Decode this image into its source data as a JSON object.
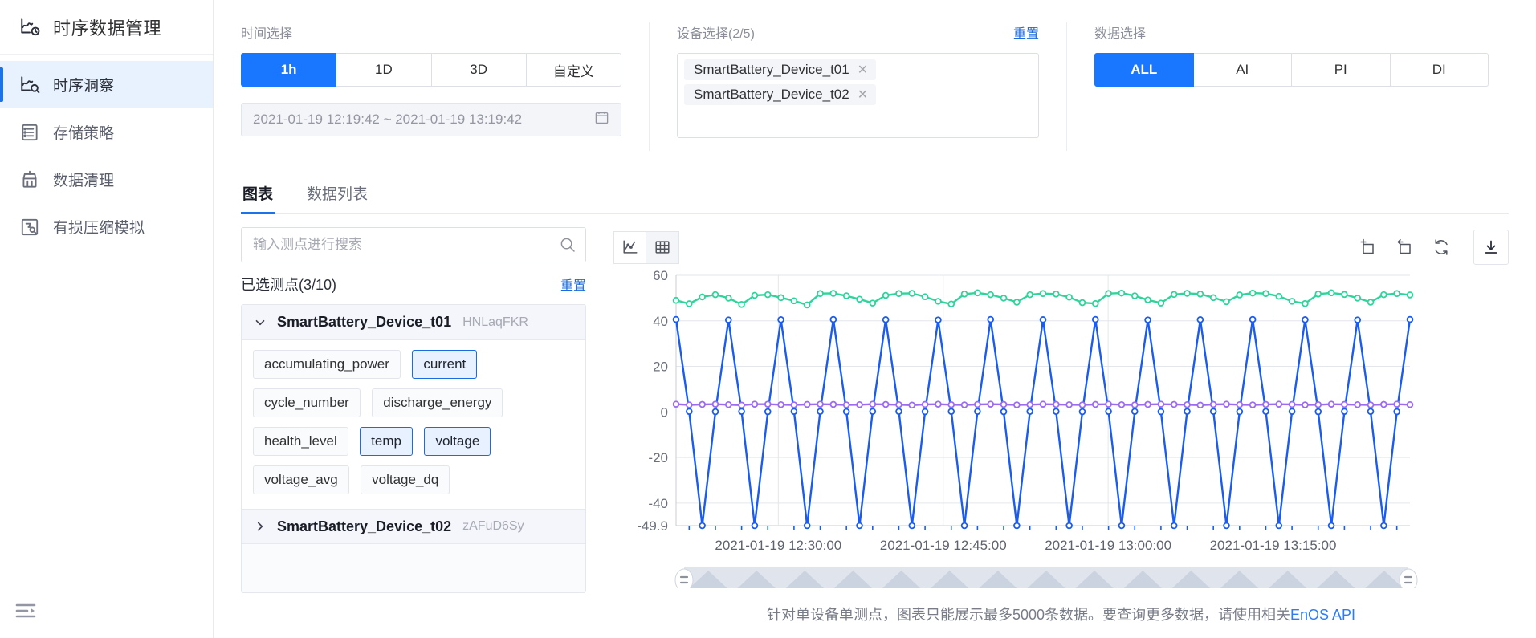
{
  "sidebar": {
    "brand": {
      "title": "时序数据管理",
      "icon": "timeseries-logo-icon"
    },
    "items": [
      {
        "label": "时序洞察",
        "icon": "insight-chart-icon",
        "active": true
      },
      {
        "label": "存储策略",
        "icon": "storage-policy-icon",
        "active": false
      },
      {
        "label": "数据清理",
        "icon": "data-clean-icon",
        "active": false
      },
      {
        "label": "有损压缩模拟",
        "icon": "lossy-compression-icon",
        "active": false
      }
    ],
    "collapse_icon": "sidebar-collapse-icon"
  },
  "filters": {
    "time": {
      "label": "时间选择",
      "options": [
        "1h",
        "1D",
        "3D",
        "自定义"
      ],
      "selected": "1h",
      "range_value": "2021-01-19 12:19:42 ~ 2021-01-19 13:19:42",
      "calendar_icon": "calendar-icon"
    },
    "device": {
      "label": "设备选择(2/5)",
      "reset_label": "重置",
      "tags": [
        "SmartBattery_Device_t01",
        "SmartBattery_Device_t02"
      ],
      "remove_icon": "close-icon"
    },
    "datatype": {
      "label": "数据选择",
      "options": [
        "ALL",
        "AI",
        "PI",
        "DI"
      ],
      "selected": "ALL"
    }
  },
  "tabs": [
    {
      "label": "图表",
      "active": true
    },
    {
      "label": "数据列表",
      "active": false
    }
  ],
  "points_panel": {
    "search_placeholder": "输入测点进行搜索",
    "search_value": "",
    "search_icon": "search-icon",
    "selected_label": "已选测点(3/10)",
    "reset_label": "重置",
    "devices": [
      {
        "name": "SmartBattery_Device_t01",
        "uid": "HNLaqFKR",
        "expanded": true,
        "tags": [
          {
            "label": "accumulating_power",
            "selected": false
          },
          {
            "label": "current",
            "selected": true
          },
          {
            "label": "cycle_number",
            "selected": false
          },
          {
            "label": "discharge_energy",
            "selected": false
          },
          {
            "label": "health_level",
            "selected": false
          },
          {
            "label": "temp",
            "selected": true
          },
          {
            "label": "voltage",
            "selected": true
          },
          {
            "label": "voltage_avg",
            "selected": false
          },
          {
            "label": "voltage_dq",
            "selected": false
          }
        ]
      },
      {
        "name": "SmartBattery_Device_t02",
        "uid": "zAFuD6Sy",
        "expanded": false,
        "tags": []
      }
    ]
  },
  "chart_toolbar": {
    "view_line_icon": "line-chart-icon",
    "view_table_icon": "table-icon",
    "view_selected": "line-chart-icon",
    "zoom_in_icon": "area-zoom-icon",
    "zoom_back_icon": "zoom-restore-icon",
    "refresh_icon": "refresh-icon",
    "download_icon": "download-icon"
  },
  "footnote": {
    "text_before": "针对单设备单测点，图表只能展示最多5000条数据。要查询更多数据，请使用相关",
    "link": "EnOS API"
  },
  "colors": {
    "accent": "#1976ff",
    "link": "#1a6ae0",
    "series_current": "#1a5cf0",
    "series_temp": "#2fd49a",
    "series_voltage": "#9b6bf0",
    "grid": "#e3e6ea"
  },
  "chart_data": {
    "type": "line",
    "title": "",
    "xlabel": "",
    "ylabel": "",
    "grid": true,
    "legend": "none",
    "ylim": [
      -49.9,
      60
    ],
    "yticks": [
      60,
      40,
      20,
      0,
      -20,
      -40,
      -49.9
    ],
    "xticks": [
      "2021-01-19 12:30:00",
      "2021-01-19 12:45:00",
      "2021-01-19 13:00:00",
      "2021-01-19 13:15:00"
    ],
    "x_range": [
      "2021-01-19 12:19:42",
      "2021-01-19 13:19:42"
    ],
    "series": [
      {
        "name": "current",
        "color": "#1a5cf0",
        "values": [
          40.6,
          0.2,
          -49.9,
          0.1,
          40.4,
          0.2,
          -49.9,
          0.1,
          40.5,
          0.2,
          -49.9,
          0.2,
          40.6,
          0.1,
          -49.9,
          0.2,
          40.5,
          0.2,
          -49.9,
          0.1,
          40.4,
          0.2,
          -49.9,
          0.2,
          40.6,
          0.1,
          -49.9,
          0.2,
          40.5,
          0.2,
          -49.9,
          0.1,
          40.6,
          0.2,
          -49.9,
          0.2,
          40.4,
          0.1,
          -49.9,
          0.2,
          40.5,
          0.2,
          -49.9,
          0.1,
          40.6,
          0.2,
          -49.9,
          0.2,
          40.5,
          0.1,
          -49.9,
          0.2,
          40.4,
          0.2,
          -49.9,
          0.1,
          40.6
        ]
      },
      {
        "name": "temp",
        "color": "#2fd49a",
        "values": [
          49.0,
          47.5,
          50.5,
          51.5,
          50.0,
          47.2,
          51.2,
          51.5,
          50.2,
          48.8,
          47.0,
          52.0,
          52.1,
          51.0,
          49.5,
          47.8,
          51.2,
          52.0,
          52.1,
          50.6,
          48.6,
          47.4,
          51.8,
          52.3,
          51.5,
          50.0,
          48.2,
          51.5,
          52.0,
          51.8,
          50.4,
          48.0,
          47.6,
          52.0,
          52.2,
          51.0,
          49.2,
          47.8,
          51.6,
          52.1,
          51.8,
          50.2,
          48.4,
          51.4,
          52.2,
          52.0,
          50.8,
          48.6,
          47.6,
          51.8,
          52.3,
          51.6,
          50.0,
          48.2,
          51.5,
          52.0,
          51.4
        ]
      },
      {
        "name": "voltage",
        "color": "#9b6bf0",
        "values": [
          3.4,
          3.1,
          3.3,
          3.4,
          3.2,
          3.0,
          3.4,
          3.4,
          3.2,
          3.1,
          3.3,
          3.4,
          3.3,
          3.1,
          3.2,
          3.4,
          3.3,
          3.2,
          3.0,
          3.3,
          3.4,
          3.2,
          3.1,
          3.3,
          3.4,
          3.3,
          3.1,
          3.2,
          3.4,
          3.3,
          3.2,
          3.1,
          3.3,
          3.4,
          3.2,
          3.1,
          3.3,
          3.4,
          3.3,
          3.2,
          3.0,
          3.3,
          3.4,
          3.2,
          3.1,
          3.3,
          3.4,
          3.3,
          3.1,
          3.2,
          3.4,
          3.3,
          3.2,
          3.1,
          3.3,
          3.4,
          3.2
        ]
      }
    ],
    "datazoom": {
      "start_percent": 0,
      "end_percent": 100
    }
  }
}
